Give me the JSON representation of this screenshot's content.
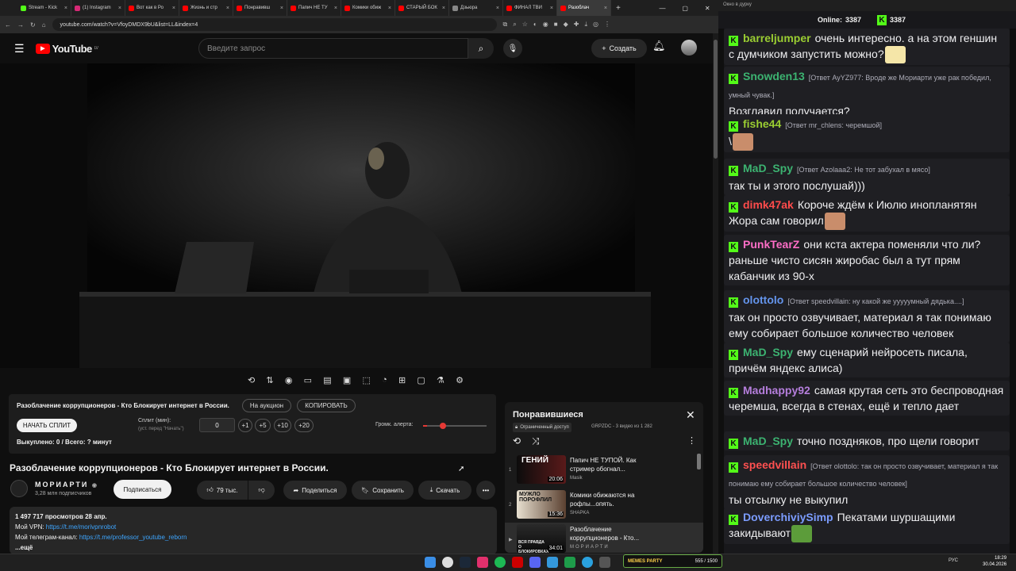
{
  "browser": {
    "tabs": [
      {
        "label": "Stream - Kick",
        "color": "#53fc18"
      },
      {
        "label": "(1) Instagram",
        "color": "#d62976"
      },
      {
        "label": "Вот как в Ро",
        "color": "#ff0000"
      },
      {
        "label": "Жизнь и стр",
        "color": "#ff0000"
      },
      {
        "label": "Понравивш",
        "color": "#ff0000"
      },
      {
        "label": "Папич НЕ ТУ",
        "color": "#ff0000"
      },
      {
        "label": "Комики обиж",
        "color": "#ff0000"
      },
      {
        "label": "СТАРЫЙ БОК",
        "color": "#ff0000"
      },
      {
        "label": "Дзьюра",
        "color": "#888888"
      },
      {
        "label": "ФИНАЛ ТВИ",
        "color": "#ff0000"
      },
      {
        "label": "Разоблач",
        "color": "#ff0000"
      }
    ],
    "new_tab": "+",
    "url": "youtube.com/watch?v=VfoyDMDX9bU&list=LL&index=4",
    "window_controls": [
      "—",
      "▢",
      "✕"
    ]
  },
  "youtube": {
    "logo_text": "YouTube",
    "logo_region": "LV",
    "search_placeholder": "Введите запрос",
    "create_label": "Создать"
  },
  "auction": {
    "title": "Разоблачение коррупционеров - Кто Блокирует интернет в России.",
    "on_auction_label": "На аукцион",
    "copy_label": "КОПИРОВАТЬ",
    "start_split_label": "НАЧАТЬ СПЛИТ",
    "split_label": "Сплит (мин):",
    "split_hint": "(уст. перед \"Начать\")",
    "split_value": "0",
    "increments": [
      "+1",
      "+5",
      "+10",
      "+20"
    ],
    "alert_volume_label": "Громк. алерта:",
    "alert_volume": 0.06,
    "paid_text": "Выкуплено: 0 / Всего: ? минут"
  },
  "video": {
    "title": "Разоблачение коррупционеров - Кто Блокирует интернет в России.",
    "channel": "МОРИАРТИ",
    "subscribers": "3,28 млн подписчиков",
    "subscribe_label": "Подписаться",
    "likes": "79 тыс.",
    "share_label": "Поделиться",
    "save_label": "Сохранить",
    "download_label": "Скачать",
    "description": {
      "stats": "1 497 717 просмотров  28 апр.",
      "vpn_label": "Мой VPN: ",
      "vpn_link": "https://t.me/morivpnrobot",
      "tg_label": "Мой телеграм-канал: ",
      "tg_link": "https://t.me/professor_youtube_reborn",
      "more": "...ещё"
    }
  },
  "playlist": {
    "title": "Понравившиеся",
    "access": "Ограниченный доступ",
    "meta": "GRPZDC - 3 видео из 1 282",
    "items": [
      {
        "num": "1",
        "title": "Папич НЕ ТУПОЙ. Как стример обогнал...",
        "channel": "Masik",
        "duration": "20:06",
        "thumb_text": "ГЕНИЙ"
      },
      {
        "num": "2",
        "title": "Комики обижаются на рофлы...опять.",
        "channel": "SHAPKA",
        "duration": "15:36",
        "thumb_text": "МУЖЛО ПОРОФЛИЛ"
      },
      {
        "num": "▶",
        "title": "Разоблачение коррупционеров - Кто...",
        "channel": "МОРИАРТИ",
        "duration": "34:01",
        "thumb_text": "ВСЯ ПРАВДА О БЛОКИРОВКАХ"
      }
    ]
  },
  "chat": {
    "window_title": "Окно в дурку",
    "online_label": "Online:",
    "online_count": "3387",
    "viewer_count": "3387",
    "messages": [
      {
        "user": "barreljumper",
        "color": "#9acd32",
        "reply": "",
        "text": "очень интересно. а на этом геншин с думчиком запустить можно?"
      },
      {
        "user": "Snowden13",
        "color": "#3cb371",
        "reply": "[Ответ AyYZ977: Вроде же Мориарти уже рак победил, умный чувак.]",
        "text": "Возглавил получается?"
      },
      {
        "user": "fishe44",
        "color": "#9acd32",
        "reply": "[Ответ mr_chlens: черемшой]",
        "text": "\\"
      },
      {
        "user": "MaD_Spy",
        "color": "#3cb371",
        "reply": "[Ответ Azolaaa2: Не тот забухал в мясо]",
        "text": "так ты и этого послушай)))"
      },
      {
        "user": "dimk47ak",
        "color": "#ff4b4b",
        "reply": "",
        "text": "Короче ждём к Июлю инопланятян Жора сам говорил"
      },
      {
        "user": "PunkTearZ",
        "color": "#ff6ec7",
        "reply": "",
        "text": "они кста актера поменяли что ли? раньше чисто сисян жиробас был а тут прям кабанчик из 90-х"
      },
      {
        "user": "olottolo",
        "color": "#6495ed",
        "reply": "[Ответ speedvillain: ну какой же ууууумный дядька....]",
        "text": "так он просто озвучивает, материал я так понимаю ему собирает большое количество человек"
      },
      {
        "user": "MaD_Spy",
        "color": "#3cb371",
        "reply": "",
        "text": "ему сценарий нейросеть писала, причём яндекс алиса)"
      },
      {
        "user": "Madhappy92",
        "color": "#b57edc",
        "reply": "",
        "text": "самая крутая сеть это беспроводная черемша, всегда в стенах, ещё и тепло дает"
      },
      {
        "user": "MaD_Spy",
        "color": "#3cb371",
        "reply": "",
        "text": "точно поздняков, про щели говорит"
      },
      {
        "user": "speedvillain",
        "color": "#ff5050",
        "reply": "[Ответ olottolo: так он просто озвучивает, материал я так понимаю ему собирает большое количество человек]",
        "text": "ты отсылку не выкупил"
      },
      {
        "user": "DoverchiviySimp",
        "color": "#7b9cff",
        "reply": "",
        "text": "Пекатами шуршащими закидывают"
      }
    ]
  },
  "taskbar": {
    "memes_label": "MEMES PARTY",
    "memes_count": "555 / 1500",
    "lang": "РУС",
    "time": "18:29",
    "date": "30.04.2026"
  }
}
